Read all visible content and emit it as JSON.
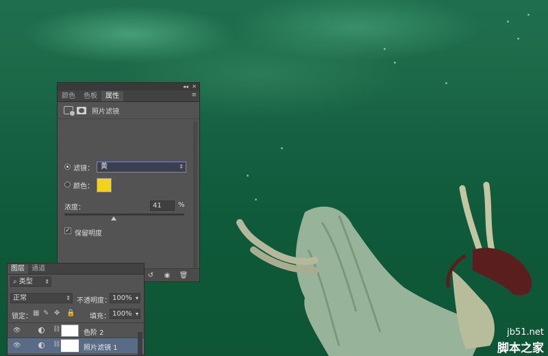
{
  "properties_panel": {
    "tabs": [
      "颜色",
      "色板",
      "属性"
    ],
    "active_tab": "属性",
    "panel_title": "照片滤镜",
    "filter_label": "滤镜：",
    "filter_value": "黄",
    "color_label": "颜色：",
    "color_swatch": "#f2d21b",
    "density_label": "浓度：",
    "density_value": "41",
    "density_unit": "%",
    "density_percent": 41,
    "preserve_luminosity_label": "保留明度",
    "preserve_luminosity_checked": true,
    "filter_selected": true
  },
  "layers_panel": {
    "tabs": [
      "图层",
      "通道"
    ],
    "active_tab": "图层",
    "filter_kind": "类型",
    "blend_mode": "正常",
    "opacity_label": "不透明度：",
    "opacity_value": "100%",
    "lock_label": "锁定：",
    "fill_label": "填充：",
    "fill_value": "100%",
    "layers": [
      {
        "name": "色阶 2",
        "selected": false
      },
      {
        "name": "照片滤镜 1",
        "selected": true
      }
    ]
  },
  "watermark": {
    "url": "jb51.net",
    "brand": "脚本之家"
  },
  "colors": {
    "panel_bg": "#535353",
    "selection": "#5a6b85",
    "water": "#156042"
  }
}
